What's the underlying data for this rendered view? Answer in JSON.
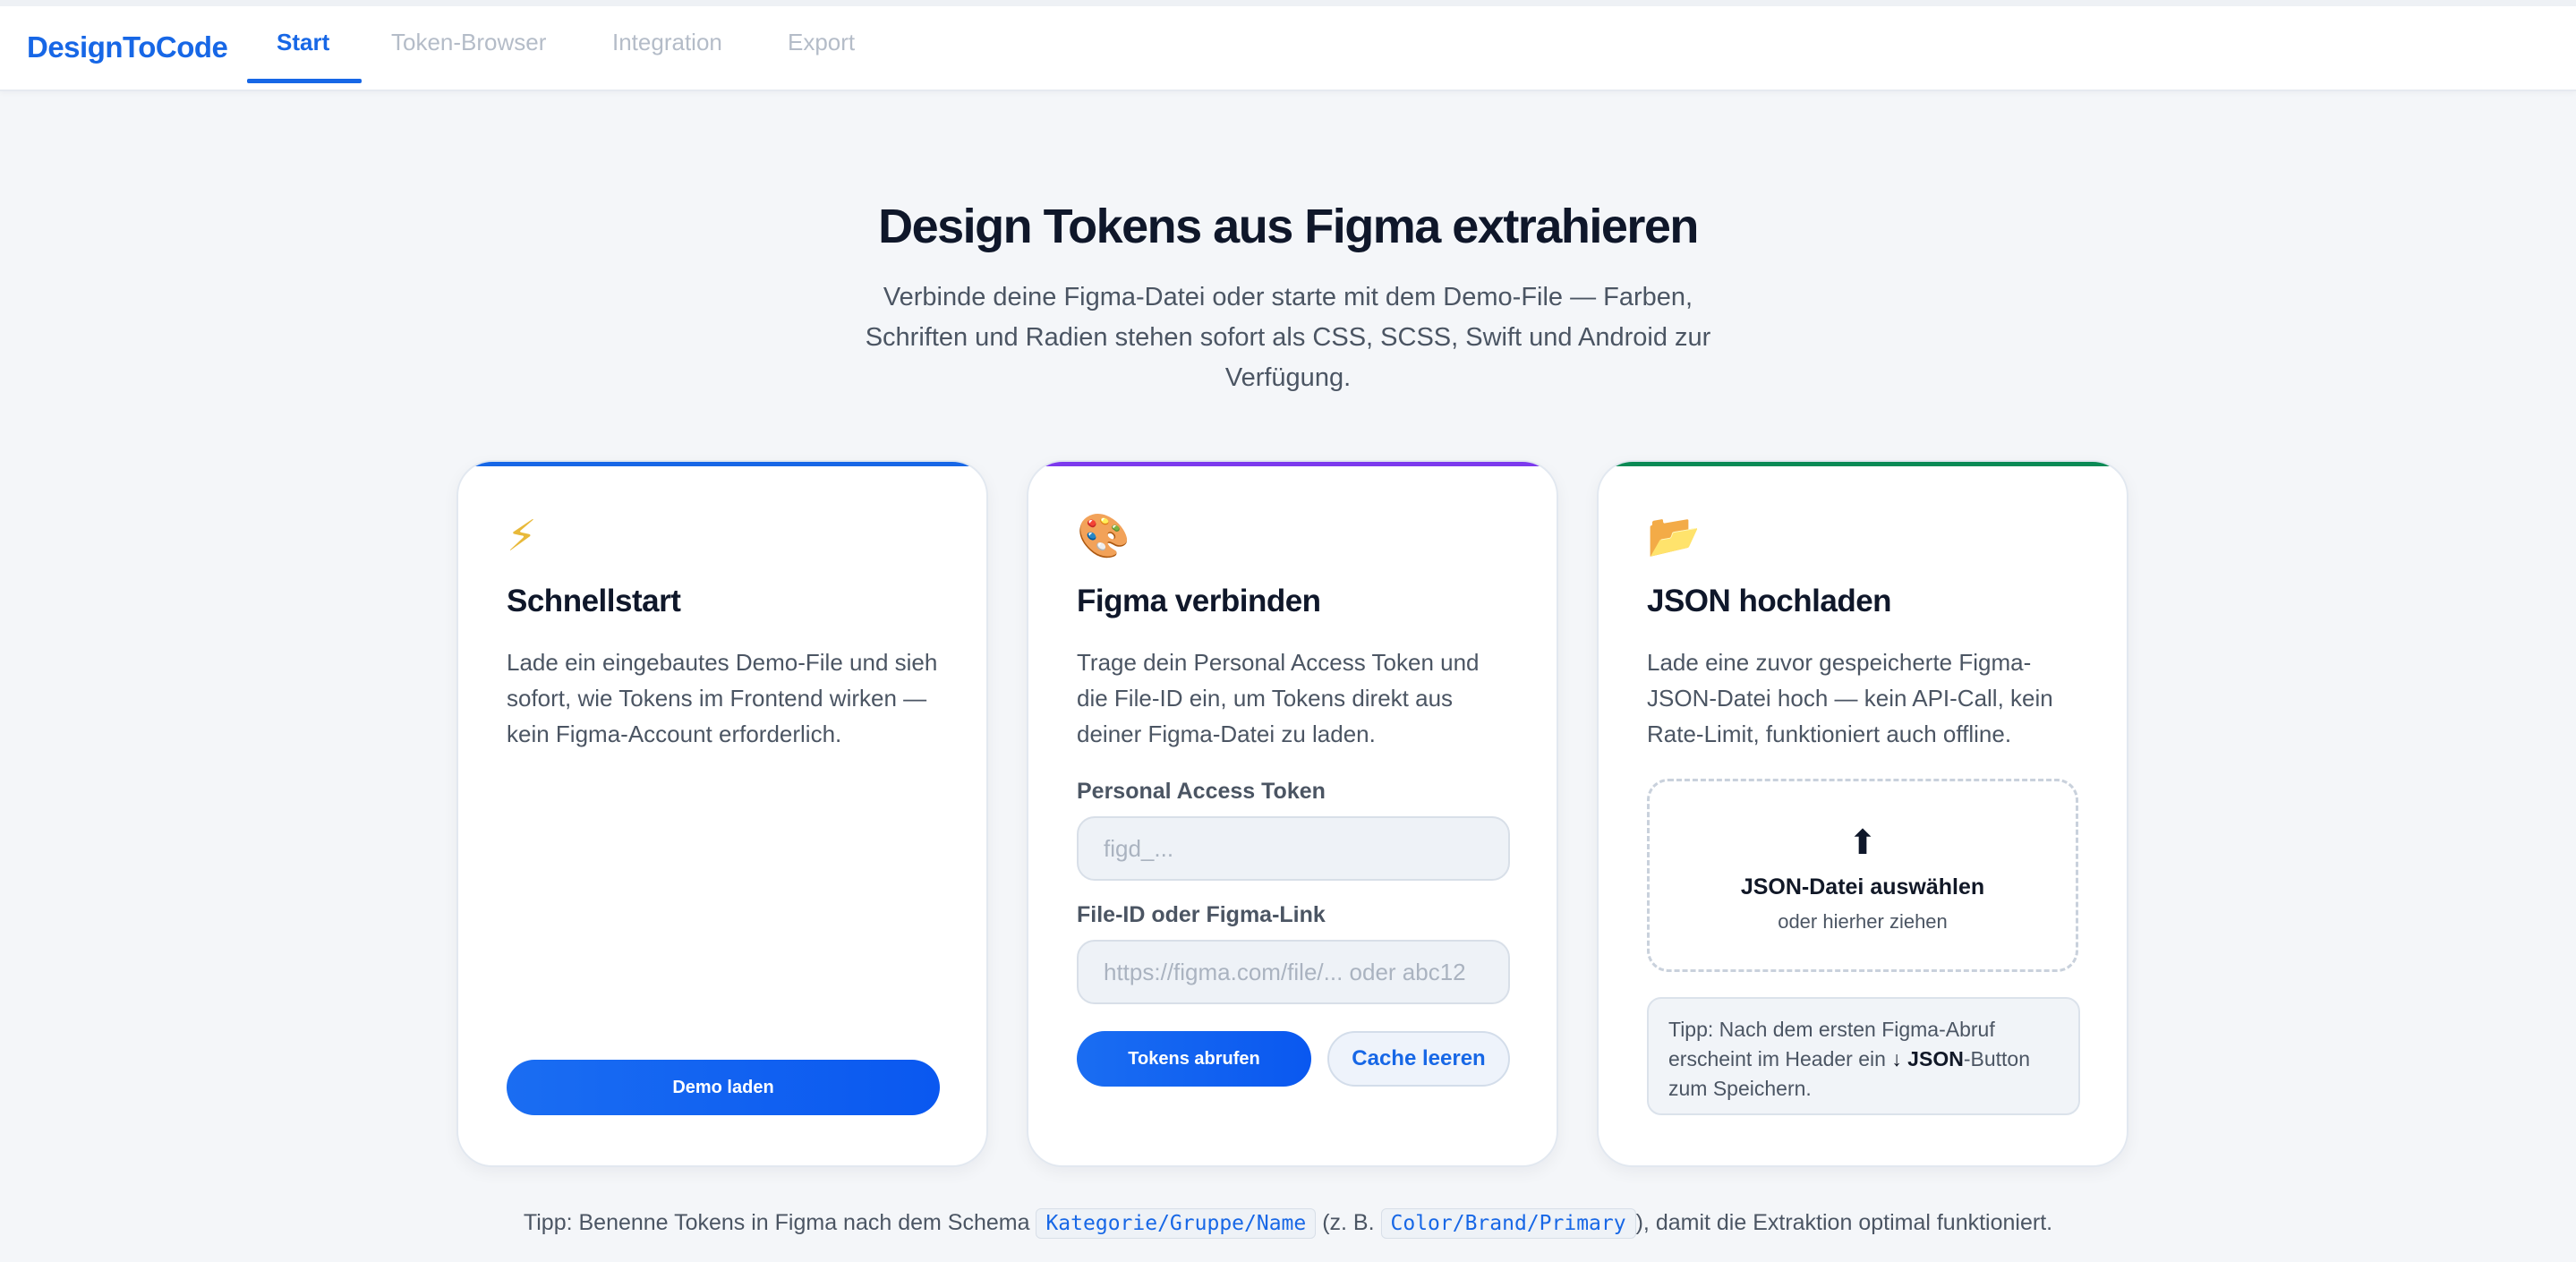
{
  "header": {
    "brand": "DesignToCode",
    "tabs": [
      {
        "label": "Start",
        "active": true
      },
      {
        "label": "Token-Browser",
        "active": false
      },
      {
        "label": "Integration",
        "active": false
      },
      {
        "label": "Export",
        "active": false
      }
    ]
  },
  "hero": {
    "title": "Design Tokens aus Figma extrahieren",
    "subtitle": "Verbinde deine Figma-Datei oder starte mit dem Demo-File — Farben, Schriften und Radien stehen sofort als CSS, SCSS, Swift und Android zur Verfügung."
  },
  "cards": {
    "quickstart": {
      "icon": "lightning-icon",
      "icon_glyph": "⚡",
      "accent": "#1767e6",
      "title": "Schnellstart",
      "text": "Lade ein eingebautes Demo-File und sieh sofort, wie Tokens im Frontend wirken — kein Figma-Account erforderlich.",
      "button": "Demo laden"
    },
    "figma": {
      "icon": "palette-icon",
      "icon_glyph": "🎨",
      "accent": "#7c3aed",
      "title": "Figma verbinden",
      "text": "Trage dein Personal Access Token und die File-ID ein, um Tokens direkt aus deiner Figma-Datei zu laden.",
      "token_label": "Personal Access Token",
      "token_placeholder": "figd_...",
      "file_label": "File-ID oder Figma-Link",
      "file_placeholder": "https://figma.com/file/... oder abc12",
      "fetch_button": "Tokens abrufen",
      "clear_button": "Cache leeren"
    },
    "json": {
      "icon": "folder-icon",
      "icon_glyph": "📂",
      "accent": "#0a8a55",
      "title": "JSON hochladen",
      "text": "Lade eine zuvor gespeicherte Figma-JSON-Datei hoch — kein API-Call, kein Rate-Limit, funktioniert auch offline.",
      "dropzone_icon": "upload-arrow-icon",
      "dropzone_title": "JSON-Datei auswählen",
      "dropzone_sub": "oder hierher ziehen",
      "tip_prefix": "Tipp: Nach dem ersten Figma-Abruf erscheint im Header ein ",
      "tip_bold": "↓ JSON",
      "tip_suffix": "-Button zum Speichern."
    }
  },
  "footer": {
    "tip_prefix": "Tipp: Benenne Tokens in Figma nach dem Schema",
    "code1": "Kategorie/Gruppe/Name",
    "tip_middle": "(z. B.",
    "code2": "Color/Brand/Primary",
    "tip_suffix": "), damit die Extraktion optimal funktioniert."
  }
}
